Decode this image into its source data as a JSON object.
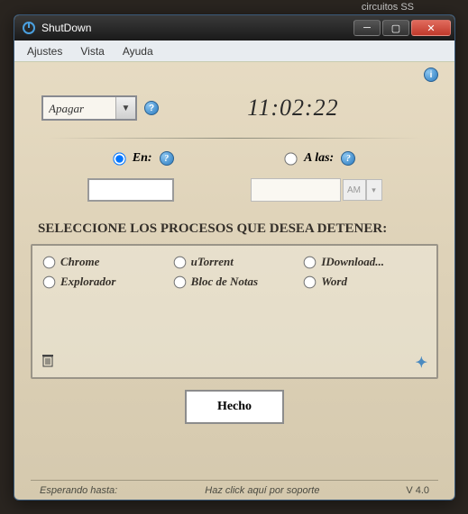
{
  "desktop_hint": "circuitos SS",
  "window": {
    "title": "ShutDown",
    "menu": [
      "Ajustes",
      "Vista",
      "Ayuda"
    ]
  },
  "action": {
    "selected": "Apagar"
  },
  "clock": "11:02:22",
  "mode": {
    "en_label": "En:",
    "alas_label": "A las:",
    "selected": "en",
    "ampm": "AM"
  },
  "processes": {
    "title": "SELECCIONE LOS PROCESOS QUE DESEA DETENER:",
    "items": [
      "Chrome",
      "uTorrent",
      "IDownload...",
      "Explorador",
      "Bloc de Notas",
      "Word"
    ]
  },
  "done_label": "Hecho",
  "status": {
    "left": "Esperando hasta:",
    "mid": "Haz click aquí por soporte",
    "right": "V 4.0"
  }
}
